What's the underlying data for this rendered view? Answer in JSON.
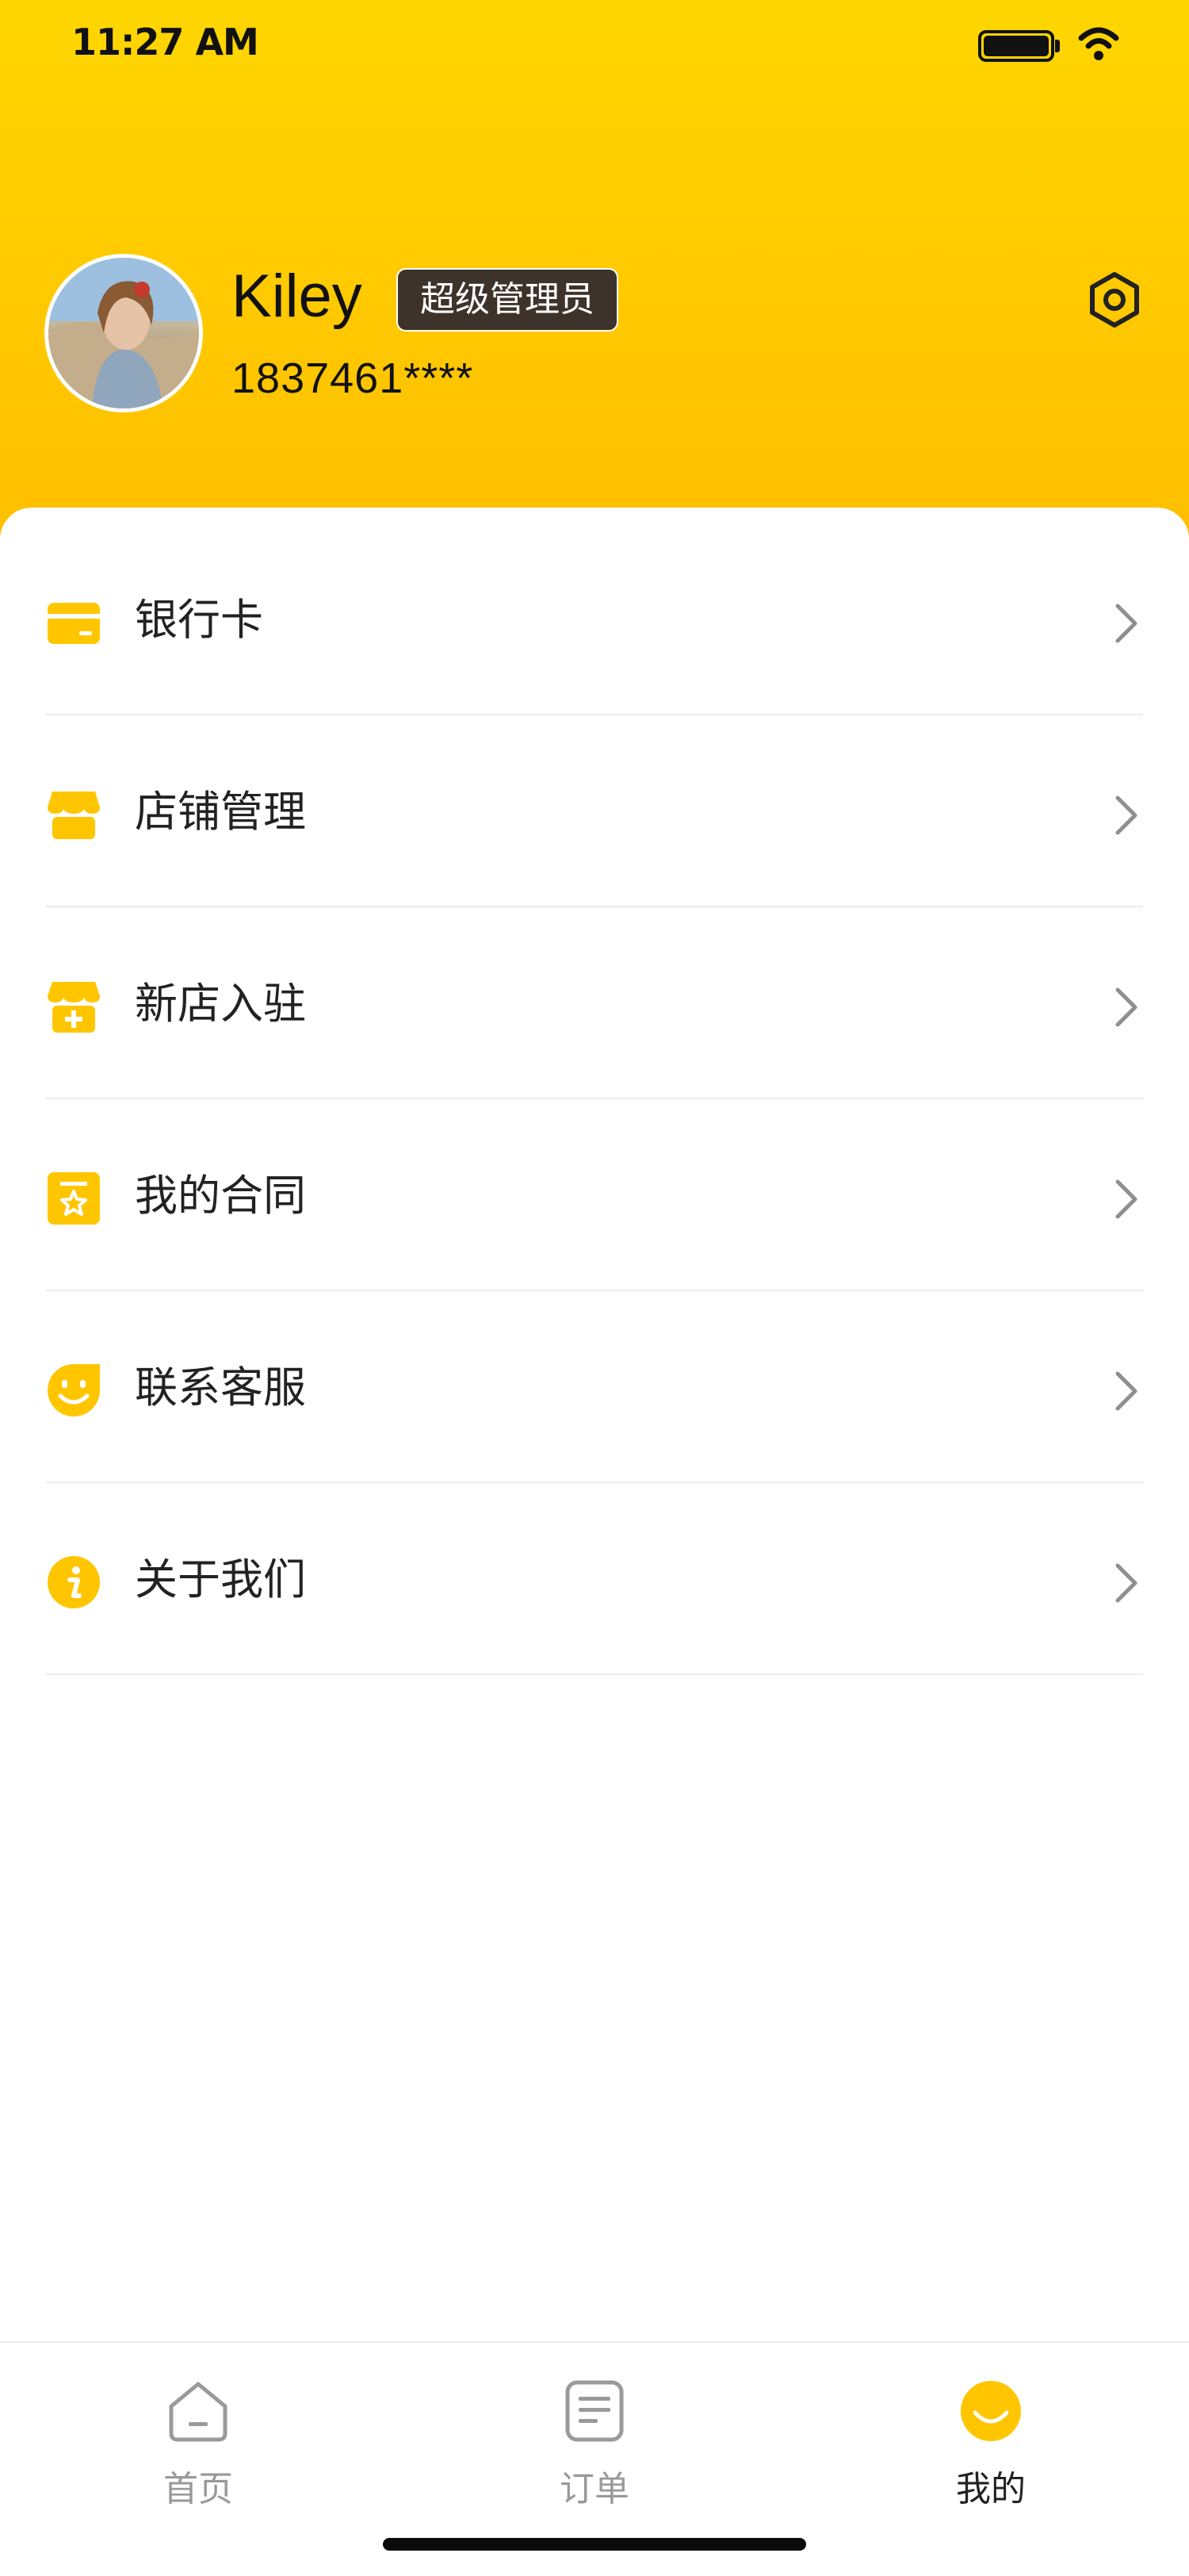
{
  "status_bar": {
    "time": "11:27 AM"
  },
  "profile": {
    "name": "Kiley",
    "role": "超级管理员",
    "phone": "1837461****"
  },
  "menu": {
    "items": [
      {
        "label": "银行卡",
        "icon": "bank-card-icon"
      },
      {
        "label": "店铺管理",
        "icon": "shop-icon"
      },
      {
        "label": "新店入驻",
        "icon": "shop-add-icon"
      },
      {
        "label": "我的合同",
        "icon": "contract-icon"
      },
      {
        "label": "联系客服",
        "icon": "customer-service-icon"
      },
      {
        "label": "关于我们",
        "icon": "info-icon"
      }
    ]
  },
  "tabbar": {
    "tabs": [
      {
        "label": "首页",
        "icon": "home-icon",
        "active": false
      },
      {
        "label": "订单",
        "icon": "order-icon",
        "active": false
      },
      {
        "label": "我的",
        "icon": "me-icon",
        "active": true
      }
    ]
  },
  "colors": {
    "accent": "#FFC600",
    "header_top": "#FFD600",
    "header_bottom": "#FFBE00",
    "badge_bg": "#3D332B",
    "divider": "#ECECEC"
  }
}
